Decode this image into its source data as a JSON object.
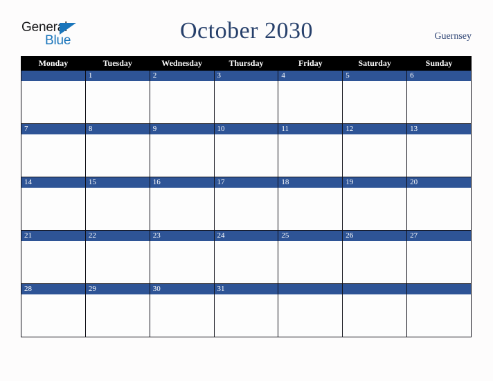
{
  "brand": {
    "name_part1": "General",
    "name_part2": "Blue",
    "triangle_color": "#1a75bb",
    "text_color": "#19191b"
  },
  "header": {
    "title": "October 2030",
    "location": "Guernsey",
    "title_color": "#27406b",
    "location_color": "#2d4373"
  },
  "calendar": {
    "month": "October",
    "year": "2030",
    "accent_color": "#2e5496",
    "header_bg": "#000000",
    "header_fg": "#ffffff",
    "cell_bg": "#fdfdfd",
    "day_names": [
      "Monday",
      "Tuesday",
      "Wednesday",
      "Thursday",
      "Friday",
      "Saturday",
      "Sunday"
    ],
    "weeks": [
      [
        "",
        "1",
        "2",
        "3",
        "4",
        "5",
        "6"
      ],
      [
        "7",
        "8",
        "9",
        "10",
        "11",
        "12",
        "13"
      ],
      [
        "14",
        "15",
        "16",
        "17",
        "18",
        "19",
        "20"
      ],
      [
        "21",
        "22",
        "23",
        "24",
        "25",
        "26",
        "27"
      ],
      [
        "28",
        "29",
        "30",
        "31",
        "",
        "",
        ""
      ]
    ]
  }
}
